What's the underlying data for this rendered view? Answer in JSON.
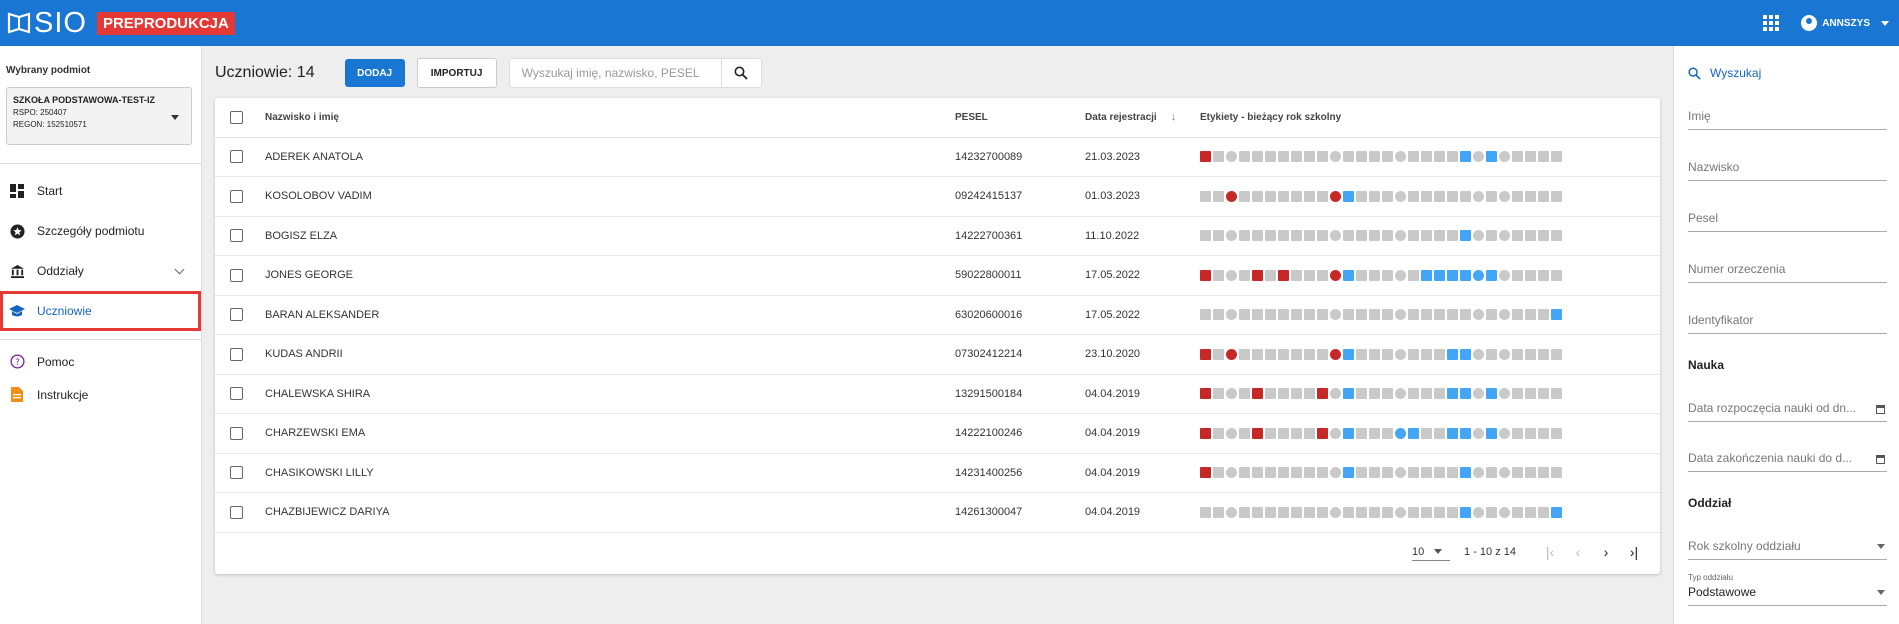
{
  "header": {
    "app_name": "SIO",
    "env_badge": "PREPRODUKCJA",
    "user_name": "ANNSZYS"
  },
  "sidebar": {
    "selected_label": "Wybrany podmiot",
    "org_name": "SZKOŁA PODSTAWOWA-TEST-IZ",
    "rspo": "RSPO: 250407",
    "regon": "REGON: 152510571",
    "nav": [
      {
        "label": "Start",
        "icon": "dashboard-icon"
      },
      {
        "label": "Szczegóły podmiotu",
        "icon": "star-circle-icon"
      },
      {
        "label": "Oddziały",
        "icon": "institution-icon"
      },
      {
        "label": "Uczniowie",
        "icon": "graduation-cap-icon"
      },
      {
        "label": "Pomoc",
        "icon": "help-circle-icon"
      },
      {
        "label": "Instrukcje",
        "icon": "document-icon"
      }
    ]
  },
  "main": {
    "title": "Uczniowie: 14",
    "add_label": "DODAJ",
    "import_label": "IMPORTUJ",
    "search_placeholder": "Wyszukaj imię, nazwisko, PESEL",
    "columns": {
      "name": "Nazwisko i imię",
      "pesel": "PESEL",
      "date": "Data rejestracji",
      "tags": "Etykiety - bieżący rok szkolny"
    },
    "rows": [
      {
        "name": "ADEREK ANATOLA",
        "pesel": "14232700089",
        "date": "21.03.2023",
        "hl": [
          0,
          20,
          22
        ]
      },
      {
        "name": "KOSOLOBOV VADIM",
        "pesel": "09242415137",
        "date": "01.03.2023",
        "hl": [
          2,
          10,
          11
        ]
      },
      {
        "name": "BOGISZ ELZA",
        "pesel": "14222700361",
        "date": "11.10.2022",
        "hl": [
          20
        ]
      },
      {
        "name": "JONES GEORGE",
        "pesel": "59022800011",
        "date": "17.05.2022",
        "hl": [
          0,
          4,
          6,
          10,
          11,
          17,
          18,
          19,
          20,
          21,
          22
        ]
      },
      {
        "name": "BARAN ALEKSANDER",
        "pesel": "63020600016",
        "date": "17.05.2022",
        "hl": [
          27
        ]
      },
      {
        "name": "KUDAS ANDRII",
        "pesel": "07302412214",
        "date": "23.10.2020",
        "hl": [
          0,
          2,
          10,
          11,
          19,
          20
        ]
      },
      {
        "name": "CHALEWSKA SHIRA",
        "pesel": "13291500184",
        "date": "04.04.2019",
        "hl": [
          0,
          4,
          9,
          11,
          19,
          20,
          22
        ]
      },
      {
        "name": "CHARZEWSKI EMA",
        "pesel": "14222100246",
        "date": "04.04.2019",
        "hl": [
          0,
          4,
          9,
          11,
          15,
          16,
          19,
          20,
          22
        ]
      },
      {
        "name": "CHASIKOWSKI LILLY",
        "pesel": "14231400256",
        "date": "04.04.2019",
        "hl": [
          0,
          11,
          20
        ]
      },
      {
        "name": "CHAZBIJEWICZ DARIYA",
        "pesel": "14261300047",
        "date": "04.04.2019",
        "hl": [
          20,
          27
        ]
      }
    ],
    "page_size": "10",
    "page_range": "1 - 10 z 14"
  },
  "filters": {
    "search_label": "Wyszukaj",
    "imie": "Imię",
    "nazwisko": "Nazwisko",
    "pesel": "Pesel",
    "numer_orzeczenia": "Numer orzeczenia",
    "identyfikator": "Identyfikator",
    "nauka_section": "Nauka",
    "data_od": "Data rozpoczęcia nauki od dn...",
    "data_do": "Data zakończenia nauki do d...",
    "oddzial_section": "Oddział",
    "rok_szkolny": "Rok szkolny oddziału",
    "typ_label": "Typ oddziału",
    "typ_value": "Podstawowe"
  },
  "colors": {
    "primary": "#1976d2",
    "badge": "#e53935",
    "tag_red": "#c62828",
    "tag_blue": "#42a5f5",
    "tag_grey": "#c9c9c9"
  }
}
